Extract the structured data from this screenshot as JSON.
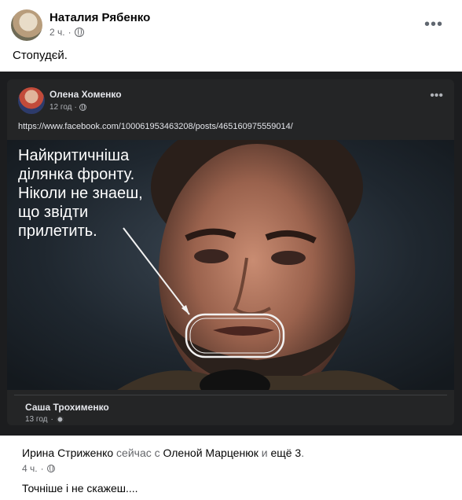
{
  "post": {
    "author": "Наталия Рябенко",
    "time": "2 ч.",
    "dot": "·",
    "text": "Стопудєй.",
    "more_icon": "more-horizontal-icon",
    "privacy_icon": "globe-icon"
  },
  "shared": {
    "author": "Олена Хоменко",
    "time": "12 год",
    "dot": "·",
    "link": "https://www.facebook.com/100061953463208/posts/465160975559014/",
    "photo_caption": "Найкритичніша\nділянка фронту.\nНіколи не знаеш,\nщо звідти\nприлетить.",
    "original_author": "Саша Трохименко",
    "original_time": "13 год",
    "original_privacy_icon": "gear-icon"
  },
  "comment": {
    "author": "Ирина Стриженко",
    "status": "сейчас с",
    "tagged": "Оленой Марценюк",
    "and": "и",
    "others": "ещё 3",
    "period": ".",
    "time": "4 ч.",
    "dot": "·",
    "text": "Точніше і не скажеш...."
  },
  "colors": {
    "link_blue": "#1877f2",
    "card_dark": "#242526",
    "meta_gray": "#65676b"
  }
}
